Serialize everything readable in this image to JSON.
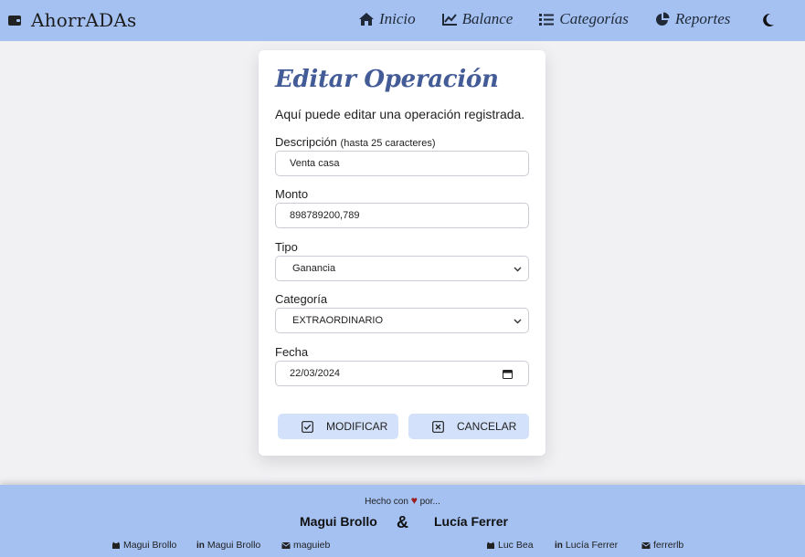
{
  "navbar": {
    "brand": "AhorrADAs",
    "links": [
      {
        "label": "Inicio",
        "icon": "home-icon"
      },
      {
        "label": "Balance",
        "icon": "chart-line-icon"
      },
      {
        "label": "Categorías",
        "icon": "list-icon"
      },
      {
        "label": "Reportes",
        "icon": "pie-chart-icon"
      }
    ],
    "theme_toggle_icon": "moon-icon"
  },
  "form": {
    "title": "Editar Operación",
    "subtitle": "Aquí puede editar una operación registrada.",
    "description": {
      "label": "Descripción",
      "hint": "(hasta 25 caracteres)",
      "value": "Venta casa"
    },
    "amount": {
      "label": "Monto",
      "value": "898789200,789"
    },
    "type": {
      "label": "Tipo",
      "value": "Ganancia"
    },
    "category": {
      "label": "Categoría",
      "value": "EXTRAORDINARIO"
    },
    "date": {
      "label": "Fecha",
      "value": "22/03/2024"
    },
    "modify_label": "MODIFICAR",
    "cancel_label": "CANCELAR"
  },
  "footer": {
    "made_prefix": "Hecho con",
    "made_suffix": "por...",
    "author1": "Magui Brollo",
    "ampersand": "&",
    "author2": "Lucía Ferrer",
    "links1": [
      {
        "icon": "github-icon",
        "label": "Magui Brollo"
      },
      {
        "icon": "linkedin-icon",
        "label": "Magui Brollo"
      },
      {
        "icon": "mail-icon",
        "label": "maguieb"
      }
    ],
    "links2": [
      {
        "icon": "github-icon",
        "label": "Luc Bea"
      },
      {
        "icon": "linkedin-icon",
        "label": "Lucía Ferrer"
      },
      {
        "icon": "mail-icon",
        "label": "ferrerlb"
      }
    ]
  },
  "colors": {
    "navbar": "#a4c1f2",
    "title": "#435c97",
    "button": "#d3e2fa",
    "heart": "#9c1c1c"
  }
}
